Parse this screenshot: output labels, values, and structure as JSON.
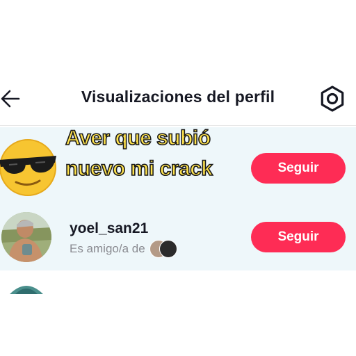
{
  "header": {
    "title": "Visualizaciones del perfil",
    "back_icon": "back-arrow-icon",
    "settings_icon": "gear-icon"
  },
  "overlay": {
    "caption": "Aver que subió nuevo mi crack",
    "emoji": "sunglasses-emoji"
  },
  "rows": [
    {
      "follow_label": "Seguir"
    },
    {
      "username": "yoel_san21",
      "subtitle": "Es amigo/a de",
      "follow_label": "Seguir"
    }
  ],
  "colors": {
    "accent": "#fe2c55",
    "list_background": "#eef7fa",
    "caption_fill": "#ffe34d"
  }
}
